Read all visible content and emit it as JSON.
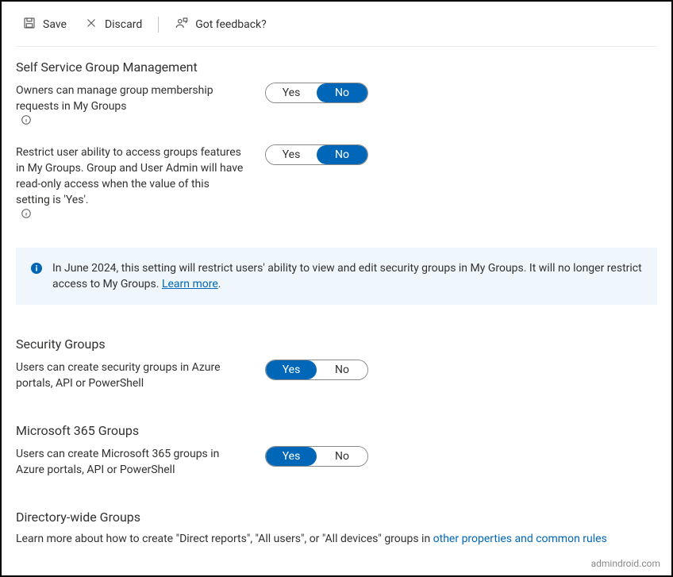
{
  "toolbar": {
    "save_label": "Save",
    "discard_label": "Discard",
    "feedback_label": "Got feedback?"
  },
  "sections": {
    "self_service": {
      "title": "Self Service Group Management",
      "owners_manage": {
        "label": "Owners can manage group membership requests in My Groups",
        "yes": "Yes",
        "no": "No",
        "value": "No"
      },
      "restrict_access": {
        "label": "Restrict user ability to access groups features in My Groups. Group and User Admin will have read-only access when the value of this setting is 'Yes'.",
        "yes": "Yes",
        "no": "No",
        "value": "No"
      }
    },
    "notice": {
      "text": "In June 2024, this setting will restrict users' ability to view and edit security groups in My Groups. It will no longer restrict access to My Groups. ",
      "link": "Learn more",
      "tail": "."
    },
    "security_groups": {
      "title": "Security Groups",
      "create": {
        "label": "Users can create security groups in Azure portals, API or PowerShell",
        "yes": "Yes",
        "no": "No",
        "value": "Yes"
      }
    },
    "m365_groups": {
      "title": "Microsoft 365 Groups",
      "create": {
        "label": "Users can create Microsoft 365 groups in Azure portals, API or PowerShell",
        "yes": "Yes",
        "no": "No",
        "value": "Yes"
      }
    },
    "directory_groups": {
      "title": "Directory-wide Groups",
      "lead": "Learn more about how to create \"Direct reports\", \"All users\", or \"All devices\" groups in ",
      "link": "other properties and common rules"
    }
  },
  "watermark": "admindroid.com"
}
